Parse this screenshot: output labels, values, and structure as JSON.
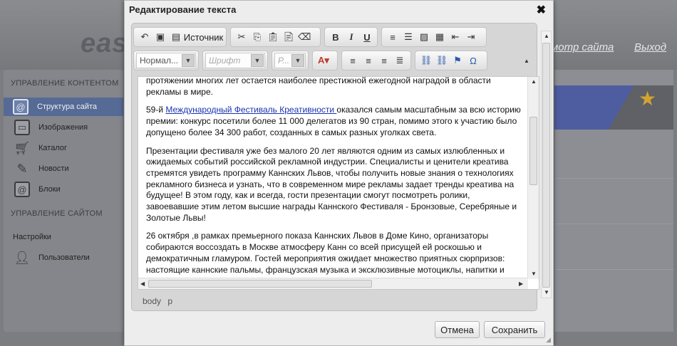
{
  "background": {
    "logo": "eas",
    "top_links": [
      "мотр сайта",
      "Выход"
    ],
    "sidebar": {
      "content_heading": "УПРАВЛЕНИЕ КОНТЕНТОМ",
      "content_items": [
        {
          "label": "Структура сайта",
          "icon": "at-icon",
          "active": true
        },
        {
          "label": "Изображения",
          "icon": "image-icon",
          "active": false
        },
        {
          "label": "Каталог",
          "icon": "cart-icon",
          "active": false
        },
        {
          "label": "Новости",
          "icon": "pencil-icon",
          "active": false
        },
        {
          "label": "Блоки",
          "icon": "at-icon",
          "active": false
        }
      ],
      "site_heading": "УПРАВЛЕНИЕ САЙТОМ",
      "site_items": [
        {
          "label": "Настройки"
        },
        {
          "label": "Пользователи",
          "icon": "user-icon"
        }
      ]
    }
  },
  "dialog": {
    "title": "Редактирование текста",
    "close_glyph": "✖",
    "toolbar": {
      "source_label": "Источник",
      "format_select": "Нормал...",
      "font_select": "Шрифт",
      "size_select": "Р...",
      "bold": "B",
      "italic": "I",
      "underline": "U"
    },
    "content": {
      "p1": "протяжении многих лет остается наиболее престижной ежегодной наградой в области рекламы в мире.",
      "p2_prefix": "59-й ",
      "p2_link": "Международный Фестиваль Креативности ",
      "p2_rest": "оказался самым масштабным за всю историю премии: конкурс посетили более 11 000 делегатов из 90 стран, помимо этого к участию было допущено более 34 300 работ, созданных в самых разных уголках света.",
      "p3": "Презентации фестиваля уже без малого 20 лет являются одним из самых излюбленных и ожидаемых событий российской рекламной индустрии. Специалисты и ценители креатива стремятся увидеть программу Каннских Львов, чтобы получить новые знания о технологиях рекламного бизнеса и узнать, что в современном мире рекламы задает тренды креатива на будущее! В этом году, как и всегда, гости презентации смогут посмотреть ролики, завоевавшие этим летом высшие награды Каннского Фестиваля - Бронзовые, Серебряные и Золотые Львы!",
      "p4": "26 октября ,в рамках премьерного показа Каннских Львов в Доме Кино, организаторы собираются воссоздать в Москве атмосферу Канн со всей присущей ей роскошью и демократичным гламуром. Гостей мероприятия ожидает множество приятных сюрпризов: настоящие каннские пальмы, французская музыка и эксклюзивные мотоциклы, напитки и"
    },
    "element_path": "body p",
    "cancel_label": "Отмена",
    "save_label": "Сохранить"
  }
}
